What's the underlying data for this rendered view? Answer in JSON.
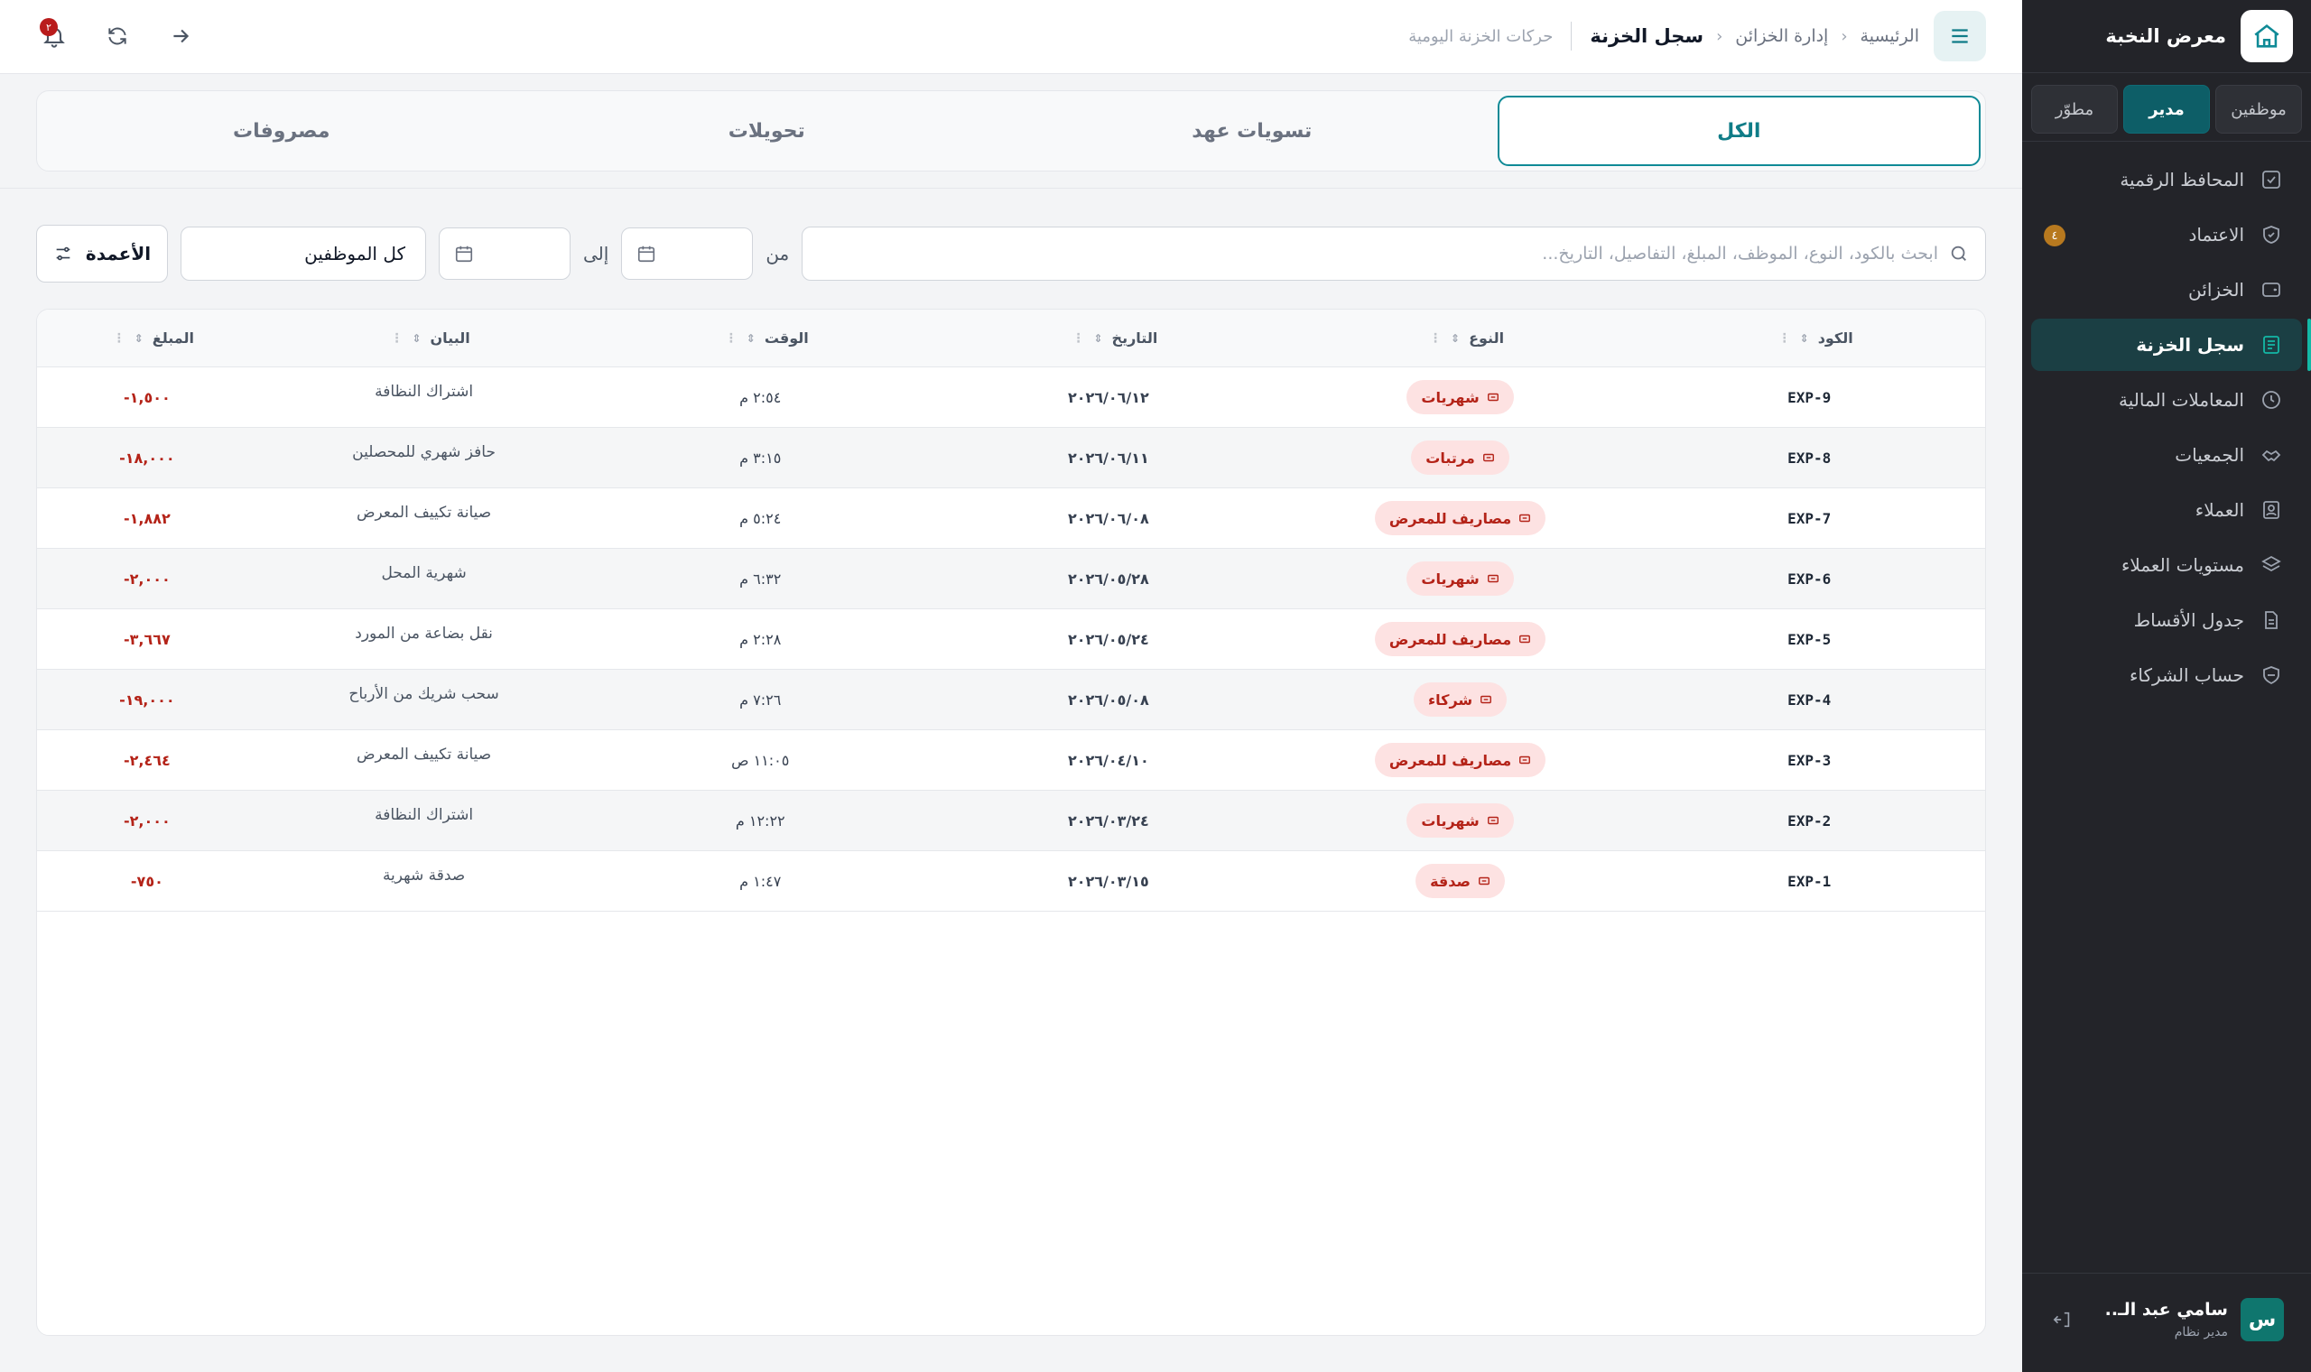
{
  "sidebar": {
    "brand": "معرض النخبة",
    "role_tabs": [
      "موظفين",
      "مدير",
      "مطوّر"
    ],
    "nav": [
      {
        "label": "المحافظ الرقمية",
        "icon": "wallet-check-icon"
      },
      {
        "label": "الاعتماد",
        "icon": "shield-check-icon",
        "badge": "٤"
      },
      {
        "label": "الخزائن",
        "icon": "safe-icon"
      },
      {
        "label": "سجل الخزنة",
        "icon": "ledger-icon"
      },
      {
        "label": "المعاملات المالية",
        "icon": "history-icon"
      },
      {
        "label": "الجمعيات",
        "icon": "handshake-icon"
      },
      {
        "label": "العملاء",
        "icon": "contact-card-icon"
      },
      {
        "label": "مستويات العملاء",
        "icon": "layers-icon"
      },
      {
        "label": "جدول الأقساط",
        "icon": "document-icon"
      },
      {
        "label": "حساب الشركاء",
        "icon": "partners-icon"
      }
    ],
    "user": {
      "initial": "س",
      "name": "سامي عبد الـ..",
      "role": "مدير نظام"
    }
  },
  "header": {
    "breadcrumb": {
      "home": "الرئيسية",
      "parent": "إدارة الخزائن",
      "current": "سجل الخزنة",
      "subtitle": "حركات الخزنة اليومية"
    },
    "notification_count": "٢"
  },
  "tabs": [
    "الكل",
    "تسويات عهد",
    "تحويلات",
    "مصروفات"
  ],
  "filters": {
    "search_placeholder": "ابحث بالكود، النوع، الموظف، المبلغ، التفاصيل، التاريخ...",
    "from_label": "من",
    "to_label": "إلى",
    "employee_select": "كل الموظفين",
    "columns_button": "الأعمدة"
  },
  "table": {
    "headers": [
      "الكود",
      "النوع",
      "التاريخ",
      "الوقت",
      "البيان",
      "المبلغ"
    ],
    "rows": [
      {
        "code": "EXP-9",
        "type": "شهريات",
        "date": "٢٠٢٦/٠٦/١٢",
        "time": "٢:٥٤ م",
        "desc": "اشتراك النظافة",
        "amount": "-١,٥٠٠"
      },
      {
        "code": "EXP-8",
        "type": "مرتبات",
        "date": "٢٠٢٦/٠٦/١١",
        "time": "٣:١٥ م",
        "desc": "حافز شهري للمحصلين",
        "amount": "-١٨,٠٠٠"
      },
      {
        "code": "EXP-7",
        "type": "مصاريف للمعرض",
        "date": "٢٠٢٦/٠٦/٠٨",
        "time": "٥:٢٤ م",
        "desc": "صيانة تكييف المعرض",
        "amount": "-١,٨٨٢"
      },
      {
        "code": "EXP-6",
        "type": "شهريات",
        "date": "٢٠٢٦/٠٥/٢٨",
        "time": "٦:٣٢ م",
        "desc": "شهرية المحل",
        "amount": "-٢,٠٠٠"
      },
      {
        "code": "EXP-5",
        "type": "مصاريف للمعرض",
        "date": "٢٠٢٦/٠٥/٢٤",
        "time": "٢:٢٨ م",
        "desc": "نقل بضاعة من المورد",
        "amount": "-٣,٦٦٧"
      },
      {
        "code": "EXP-4",
        "type": "شركاء",
        "date": "٢٠٢٦/٠٥/٠٨",
        "time": "٧:٢٦ م",
        "desc": "سحب شريك من الأرباح",
        "amount": "-١٩,٠٠٠"
      },
      {
        "code": "EXP-3",
        "type": "مصاريف للمعرض",
        "date": "٢٠٢٦/٠٤/١٠",
        "time": "١١:٠٥ ص",
        "desc": "صيانة تكييف المعرض",
        "amount": "-٢,٤٦٤"
      },
      {
        "code": "EXP-2",
        "type": "شهريات",
        "date": "٢٠٢٦/٠٣/٢٤",
        "time": "١٢:٢٢ م",
        "desc": "اشتراك النظافة",
        "amount": "-٢,٠٠٠"
      },
      {
        "code": "EXP-1",
        "type": "صدقة",
        "date": "٢٠٢٦/٠٣/١٥",
        "time": "١:٤٧ م",
        "desc": "صدقة شهرية",
        "amount": "-٧٥٠"
      }
    ]
  },
  "colors": {
    "sidebar_bg": "#232429",
    "accent": "#0f8a96",
    "negative": "#b42318",
    "badge_bg": "#fde2e2"
  }
}
